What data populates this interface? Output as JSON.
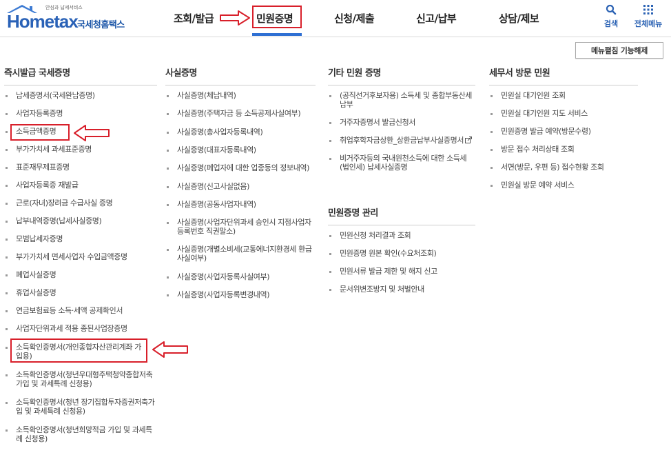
{
  "logo": {
    "tagline": "안심과 납세서비스",
    "brand": "Hometax",
    "brand_name": "국세청홈택스"
  },
  "gnb": {
    "items": [
      "조회/발급",
      "민원증명",
      "신청/제출",
      "신고/납부",
      "상담/제보"
    ],
    "active": "민원증명"
  },
  "top_util": {
    "search_label": "검색",
    "all_menu_label": "전체메뉴"
  },
  "menu_toggle_label": "메뉴펼침 기능해제",
  "columns": {
    "instant": {
      "title": "즉시발급 국세증명",
      "items": [
        "납세증명서(국세완납증명)",
        "사업자등록증명",
        "소득금액증명",
        "부가가치세 과세표준증명",
        "표준재무제표증명",
        "사업자등록증 재발급",
        "근로(자녀)장려금 수급사실 증명",
        "납부내역증명(납세사실증명)",
        "모범납세자증명",
        "부가가치세 면세사업자 수입금액증명",
        "폐업사실증명",
        "휴업사실증명",
        "연금보험료등 소득·세액 공제확인서",
        "사업자단위과세 적용 종된사업장증명",
        "소득확인증명서(개인종합자산관리계좌 가입용)",
        "소득확인증명서(청년우대형주택청약종합저축 가입 및 과세특례 신청용)",
        "소득확인증명서(청년 장기집합투자증권저축가입 및 과세특례 신청용)",
        "소득확인증명서(청년희망적금 가입 및 과세특례 신청용)"
      ]
    },
    "facts": {
      "title": "사실증명",
      "items": [
        "사실증명(체납내역)",
        "사실증명(주택자금 등 소득공제사실여부)",
        "사실증명(총사업자등록내역)",
        "사실증명(대표자등록내역)",
        "사실증명(폐업자에 대한 업종등의 정보내역)",
        "사실증명(신고사실없음)",
        "사실증명(공동사업자내역)",
        "사실증명(사업자단위과세 승인시 지점사업자등록번호 직권말소)",
        "사실증명(개별소비세(교통에너지환경세 환급사실여부)",
        "사실증명(사업자등록사실여부)",
        "사실증명(사업자등록변경내역)"
      ]
    },
    "other": {
      "title": "기타 민원 증명",
      "items": [
        "(공직선거후보자용) 소득세 및 종합부동산세 납부",
        "거주자증명서 발급신청서",
        "취업후학자금상환_상환금납부사실증명서",
        "비거주자등의 국내원천소득에 대한 소득세(법인세) 납세사실증명"
      ]
    },
    "manage": {
      "title": "민원증명 관리",
      "items": [
        "민원신청 처리결과 조회",
        "민원증명 원본 확인(수요처조회)",
        "민원서류 발급 제한 및 해지 신고",
        "문서위변조방지 및 처벌안내"
      ]
    },
    "visit": {
      "title": "세무서 방문 민원",
      "items": [
        "민원실 대기인원 조회",
        "민원실 대기인원 지도 서비스",
        "민원증명 발급 예약(방문수령)",
        "방문 접수 처리상태 조회",
        "서면(방문, 우편 등) 접수현황 조회",
        "민원실 방문 예약 서비스"
      ]
    }
  },
  "colors": {
    "accent_blue": "#2e6fd3",
    "highlight_red": "#d81f2a",
    "logo_blue": "#2a62b7"
  }
}
